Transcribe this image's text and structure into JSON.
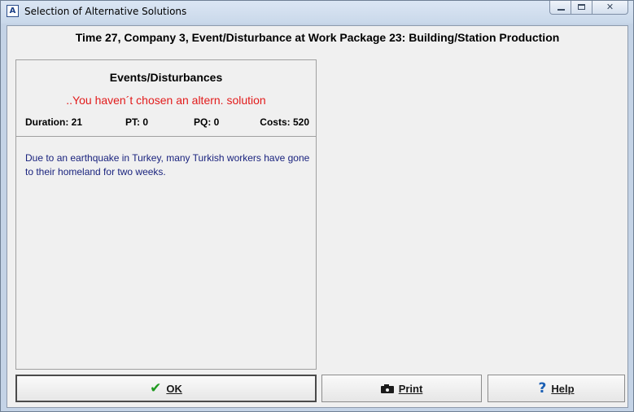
{
  "window": {
    "title": "Selection of Alternative Solutions",
    "icon": "app-icon",
    "controls": {
      "minimize": "minimize-icon",
      "maximize": "maximize-icon",
      "close": "close-icon"
    }
  },
  "header": {
    "title": "Time 27, Company 3, Event/Disturbance at Work Package 23: Building/Station Production"
  },
  "panel": {
    "title": "Events/Disturbances",
    "warning": "..You haven´t chosen an altern. solution",
    "warning_color": "#e21b1b",
    "stats": {
      "duration": "Duration: 21",
      "pt": "PT: 0",
      "pq": "PQ: 0",
      "costs": "Costs: 520"
    },
    "description": "Due to an earthquake in Turkey, many Turkish workers have gone to their homeland for two weeks.",
    "description_color": "#1a237e"
  },
  "buttons": {
    "ok": {
      "label": "OK",
      "icon": "check-icon"
    },
    "print": {
      "label": "Print",
      "icon": "camera-icon"
    },
    "help": {
      "label": "Help",
      "icon": "help-icon"
    }
  }
}
